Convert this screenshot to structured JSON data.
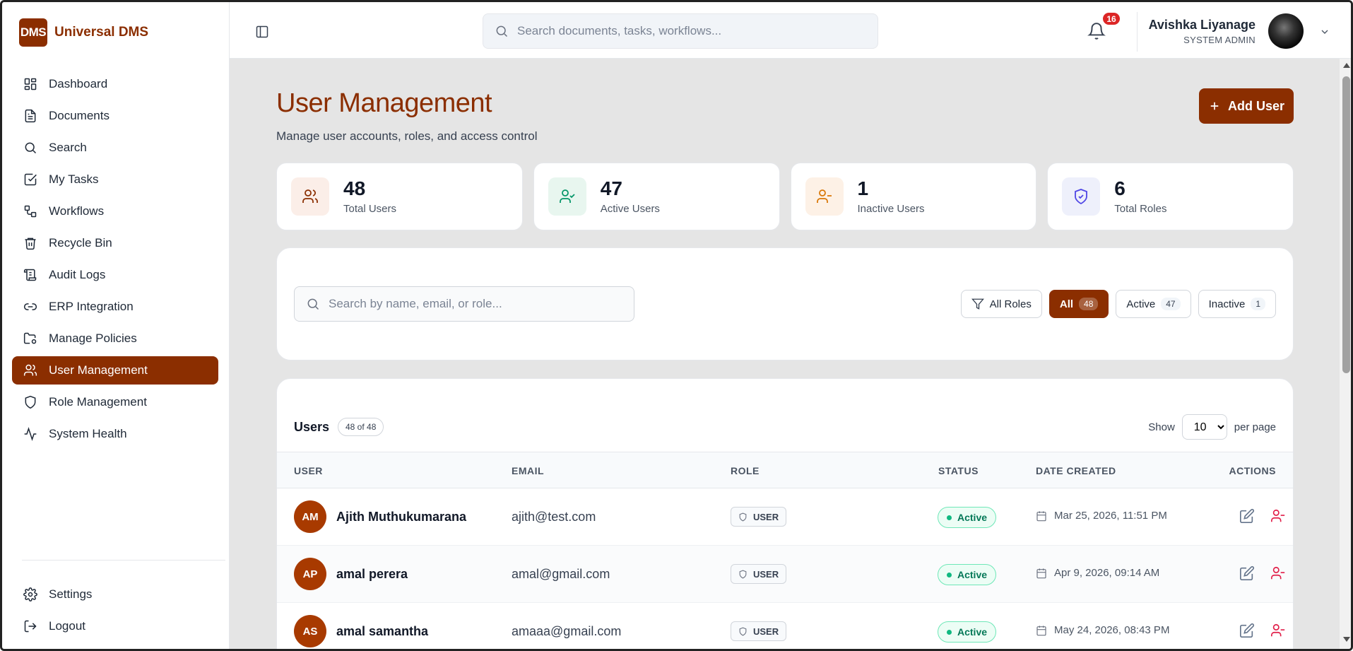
{
  "brand": {
    "logo_text": "DMS",
    "name": "Universal DMS"
  },
  "sidebar": {
    "items": [
      {
        "label": "Dashboard",
        "icon": "dashboard-icon"
      },
      {
        "label": "Documents",
        "icon": "document-icon"
      },
      {
        "label": "Search",
        "icon": "search-icon"
      },
      {
        "label": "My Tasks",
        "icon": "checkbox-icon"
      },
      {
        "label": "Workflows",
        "icon": "workflow-icon"
      },
      {
        "label": "Recycle Bin",
        "icon": "trash-icon"
      },
      {
        "label": "Audit Logs",
        "icon": "scroll-icon"
      },
      {
        "label": "ERP Integration",
        "icon": "link-icon"
      },
      {
        "label": "Manage Policies",
        "icon": "folder-settings-icon"
      },
      {
        "label": "User Management",
        "icon": "users-icon",
        "active": true
      },
      {
        "label": "Role Management",
        "icon": "shield-icon"
      },
      {
        "label": "System Health",
        "icon": "activity-icon"
      }
    ],
    "bottom": [
      {
        "label": "Settings",
        "icon": "gear-icon"
      },
      {
        "label": "Logout",
        "icon": "logout-icon"
      }
    ]
  },
  "header": {
    "search_placeholder": "Search documents, tasks, workflows...",
    "notifications": "16",
    "user_name": "Avishka Liyanage",
    "user_role": "SYSTEM ADMIN"
  },
  "page": {
    "title": "User Management",
    "subtitle": "Manage user accounts, roles, and access control",
    "add_button": "Add User"
  },
  "stats": [
    {
      "value": "48",
      "label": "Total Users"
    },
    {
      "value": "47",
      "label": "Active Users"
    },
    {
      "value": "1",
      "label": "Inactive Users"
    },
    {
      "value": "6",
      "label": "Total Roles"
    }
  ],
  "filters": {
    "search_placeholder": "Search by name, email, or role...",
    "roles_label": "All Roles",
    "all_label": "All",
    "all_count": "48",
    "active_label": "Active",
    "active_count": "47",
    "inactive_label": "Inactive",
    "inactive_count": "1"
  },
  "users": {
    "title": "Users",
    "count": "48 of 48",
    "show_label": "Show",
    "per_page": "10",
    "per_page_label": "per page",
    "columns": [
      "USER",
      "EMAIL",
      "ROLE",
      "STATUS",
      "DATE CREATED",
      "ACTIONS"
    ],
    "rows": [
      {
        "initials": "AM",
        "name": "Ajith Muthukumarana",
        "email": "ajith@test.com",
        "role": "USER",
        "status": "Active",
        "date": "Mar 25, 2026, 11:51 PM"
      },
      {
        "initials": "AP",
        "name": "amal perera",
        "email": "amal@gmail.com",
        "role": "USER",
        "status": "Active",
        "date": "Apr 9, 2026, 09:14 AM"
      },
      {
        "initials": "AS",
        "name": "amal samantha",
        "email": "amaaa@gmail.com",
        "role": "USER",
        "status": "Active",
        "date": "May 24, 2026, 08:43 PM"
      }
    ]
  },
  "colors": {
    "brand": "#8b2e00",
    "active_green": "#047857",
    "danger": "#e11d48"
  }
}
